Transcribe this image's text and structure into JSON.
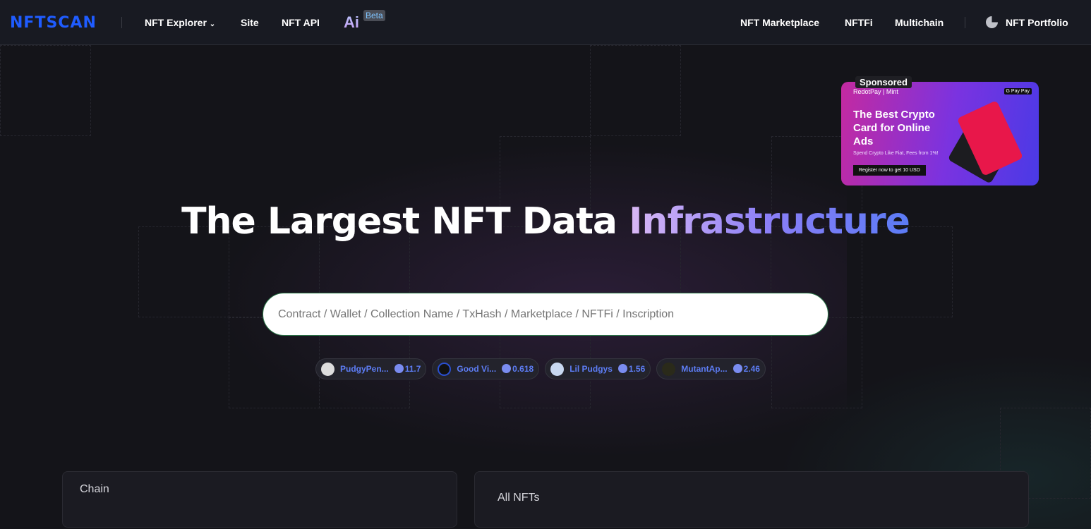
{
  "nav": {
    "logo": "NFTSCAN",
    "items": [
      "NFT Explorer",
      "Site",
      "NFT API"
    ],
    "ai": "Ai",
    "beta": "Beta",
    "right": [
      "NFT Marketplace",
      "NFTFi",
      "Multichain"
    ],
    "portfolio": "NFT Portfolio"
  },
  "ad": {
    "sponsored": "Sponsored",
    "brand": "RedotPay | Mint",
    "pay": "G Pay  Pay",
    "headline": "The Best Crypto Card for Online Ads",
    "sub": "Spend Crypto Like Fiat, Fees from 1%!",
    "cta": "Register now to get 10 USD"
  },
  "hero": {
    "title_a": "The Largest NFT Data ",
    "title_b": "Infrastructure"
  },
  "search": {
    "placeholder": "Contract / Wallet / Collection Name / TxHash / Marketplace / NFTFi / Inscription"
  },
  "trending": [
    {
      "name": "PudgyPen...",
      "price": "11.7"
    },
    {
      "name": "Good Vi...",
      "price": "0.618"
    },
    {
      "name": "Lil Pudgys",
      "price": "1.56"
    },
    {
      "name": "MutantAp...",
      "price": "2.46"
    }
  ],
  "panels": {
    "chain": "Chain",
    "all_nfts": "All NFTs"
  },
  "colors": {
    "brand": "#1f5cff",
    "accent": "#5d7df5"
  }
}
